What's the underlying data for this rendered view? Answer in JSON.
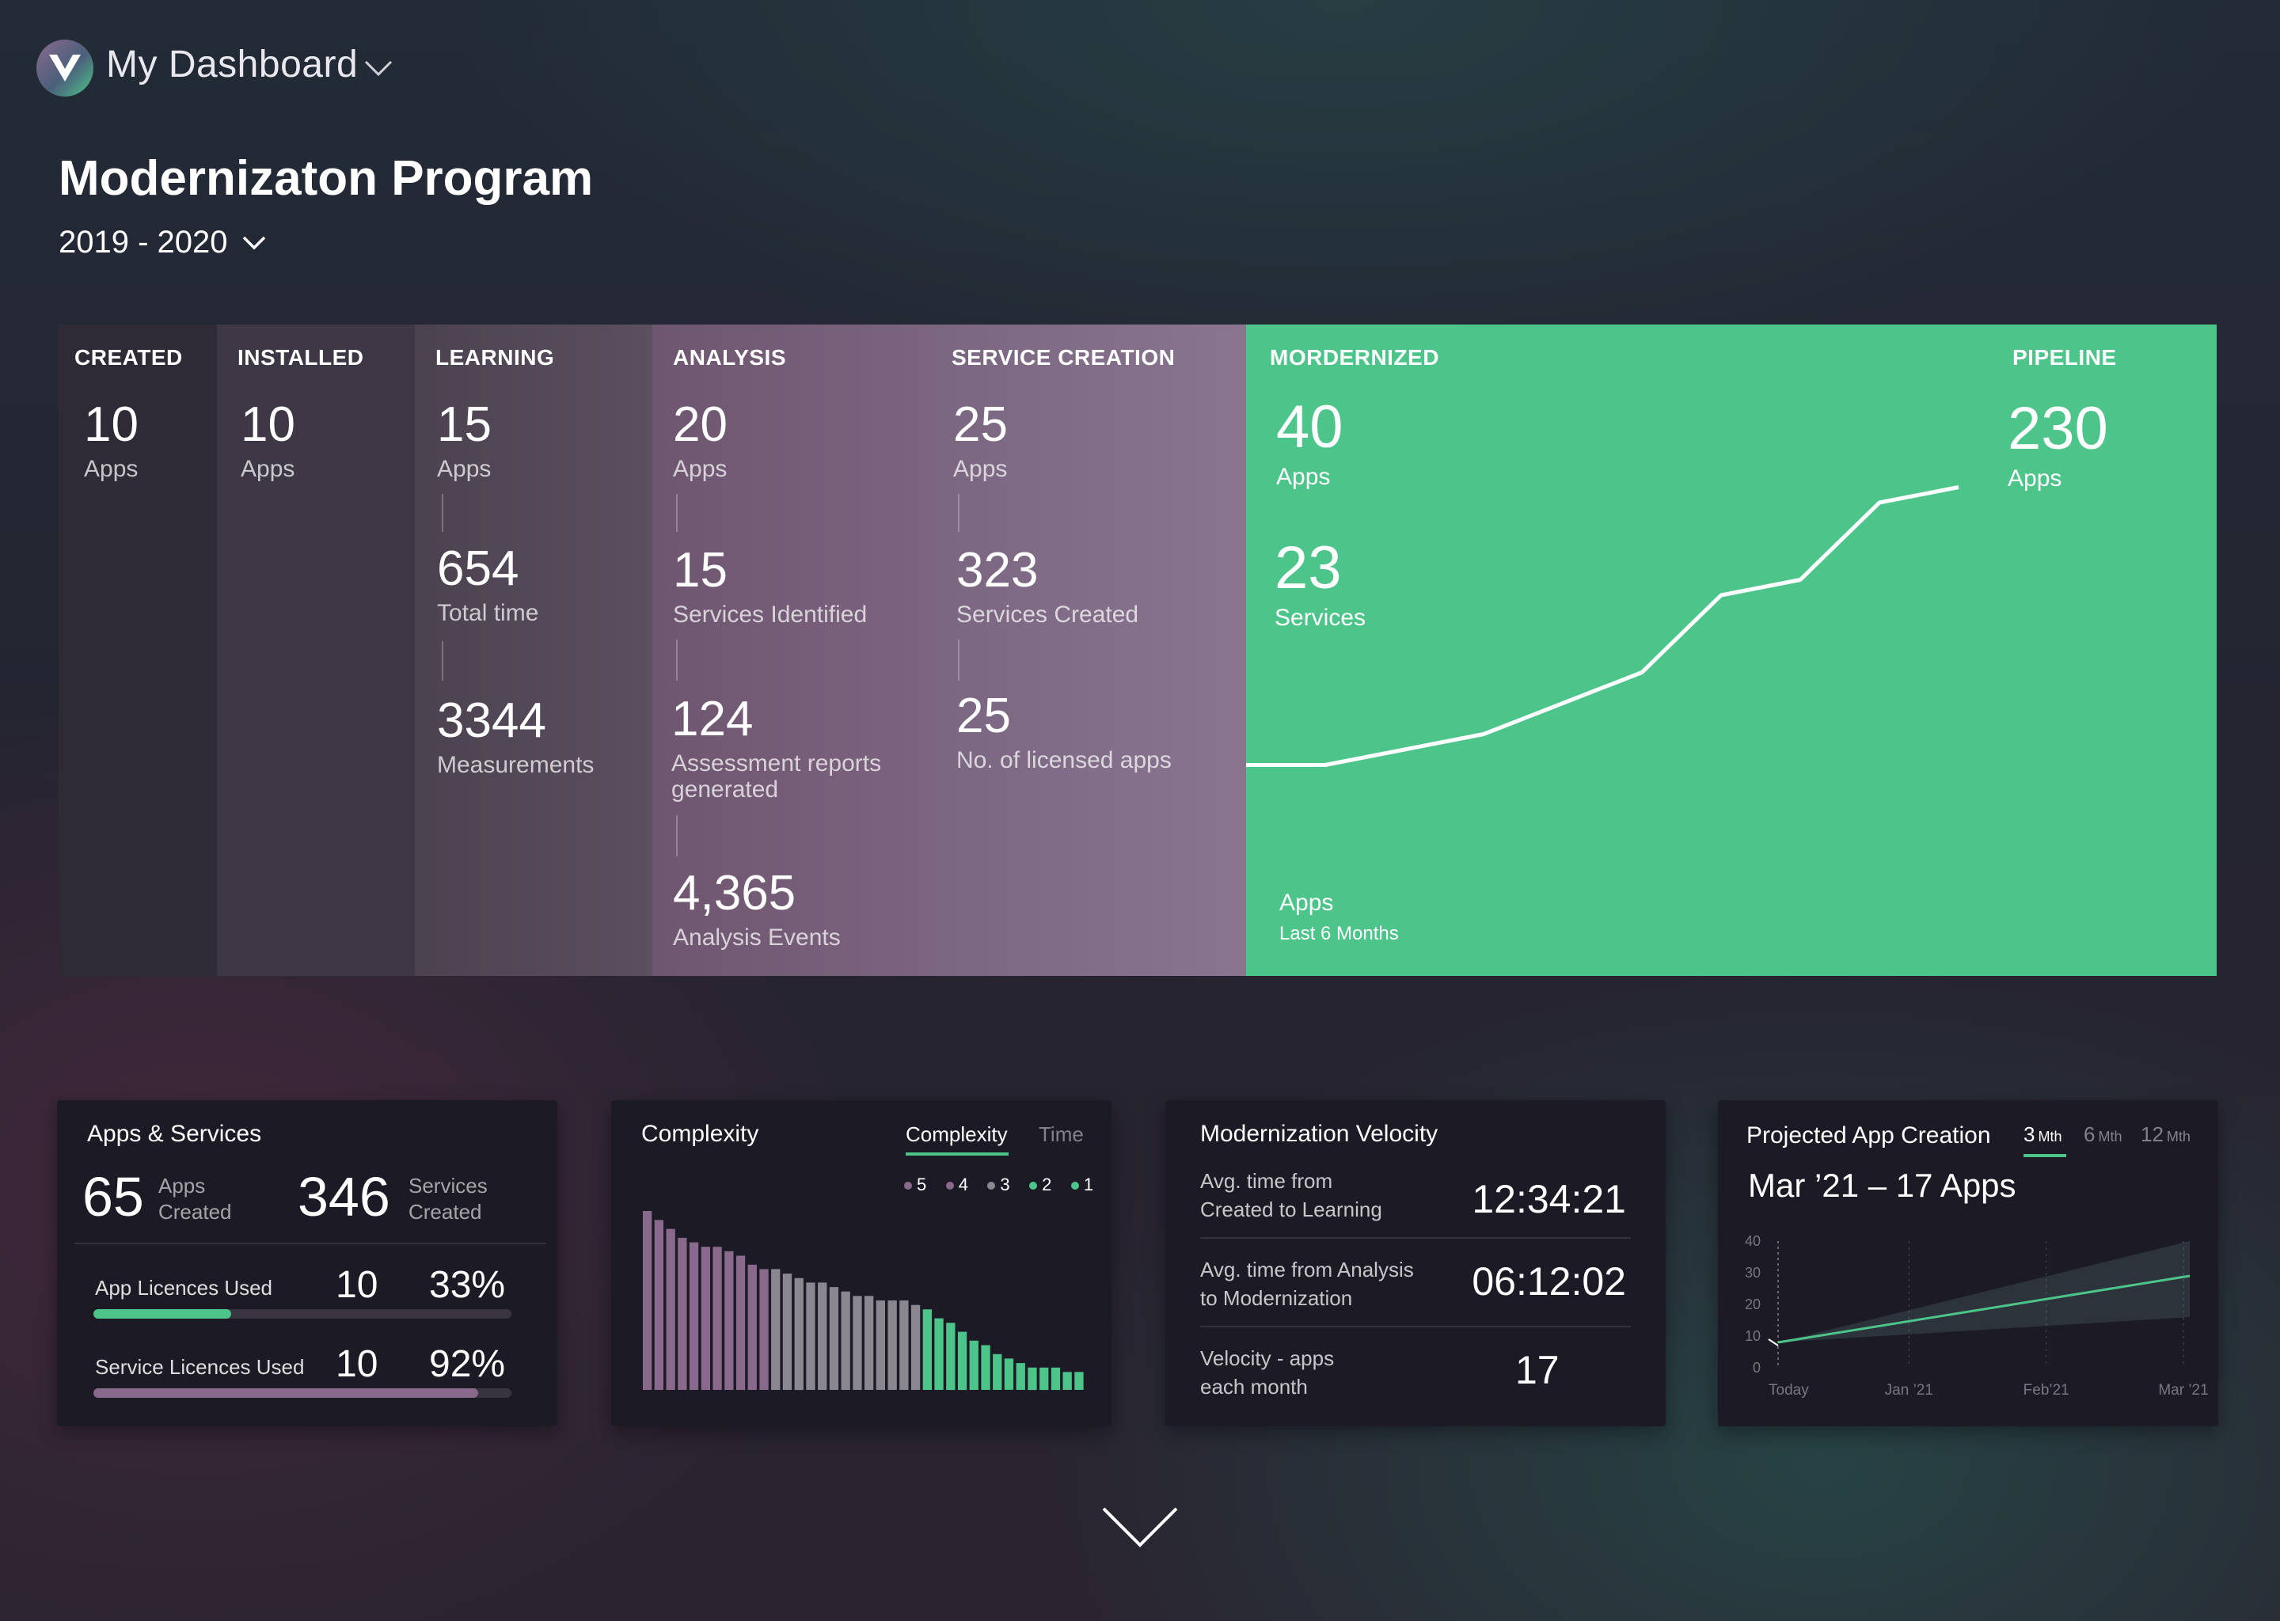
{
  "header": {
    "app_title": "My Dashboard",
    "page_title": "Modernizaton Program",
    "year_range": "2019 - 2020",
    "logo_letter": "V"
  },
  "stages": {
    "created": {
      "title": "CREATED",
      "metrics": [
        {
          "value": "10",
          "label": "Apps"
        }
      ]
    },
    "installed": {
      "title": "INSTALLED",
      "metrics": [
        {
          "value": "10",
          "label": "Apps"
        }
      ]
    },
    "learning": {
      "title": "LEARNING",
      "metrics": [
        {
          "value": "15",
          "label": "Apps"
        },
        {
          "value": "654",
          "label": "Total time"
        },
        {
          "value": "3344",
          "label": "Measurements"
        }
      ]
    },
    "analysis": {
      "title": "ANALYSIS",
      "metrics": [
        {
          "value": "20",
          "label": "Apps"
        },
        {
          "value": "15",
          "label": "Services Identified"
        },
        {
          "value": "124",
          "label": "Assessment reports generated"
        },
        {
          "value": "4,365",
          "label": "Analysis Events"
        }
      ]
    },
    "service_creation": {
      "title": "SERVICE CREATION",
      "metrics": [
        {
          "value": "25",
          "label": "Apps"
        },
        {
          "value": "323",
          "label": "Services Created"
        },
        {
          "value": "25",
          "label": "No. of licensed apps"
        }
      ]
    },
    "modernized": {
      "title": "MORDERNIZED",
      "metrics": [
        {
          "value": "40",
          "label": "Apps"
        },
        {
          "value": "23",
          "label": "Services"
        }
      ],
      "chart_label": "Apps",
      "chart_sublabel": "Last 6 Months"
    },
    "pipeline": {
      "title": "PIPELINE",
      "metrics": [
        {
          "value": "230",
          "label": "Apps"
        }
      ]
    }
  },
  "colors": {
    "accent_green": "#4dc58a",
    "purple": "#8a6a8c",
    "gray": "#8a8790",
    "card_bg": "#1c1b25"
  },
  "apps_services": {
    "title": "Apps & Services",
    "apps_created": {
      "value": "65",
      "label_1": "Apps",
      "label_2": "Created"
    },
    "services_created": {
      "value": "346",
      "label_1": "Services",
      "label_2": "Created"
    },
    "app_licences": {
      "label": "App Licences Used",
      "count": "10",
      "percent": "33%",
      "fraction": 0.33
    },
    "service_licences": {
      "label": "Service Licences Used",
      "count": "10",
      "percent": "92%",
      "fraction": 0.92
    }
  },
  "complexity": {
    "title": "Complexity",
    "tabs": [
      "Complexity",
      "Time"
    ],
    "active_tab": "Complexity",
    "legend": [
      {
        "label": "5",
        "color": "#8a6a8c"
      },
      {
        "label": "4",
        "color": "#8a6a8c"
      },
      {
        "label": "3",
        "color": "#8a8790"
      },
      {
        "label": "2",
        "color": "#4dc58a"
      },
      {
        "label": "1",
        "color": "#4dc58a"
      }
    ]
  },
  "velocity": {
    "title": "Modernization Velocity",
    "rows": [
      {
        "label_1": "Avg. time from",
        "label_2": "Created to Learning",
        "value": "12:34:21"
      },
      {
        "label_1": "Avg. time from Analysis",
        "label_2": "to Modernization",
        "value": "06:12:02"
      },
      {
        "label_1": "Velocity -  apps",
        "label_2": "each month",
        "value": "17"
      }
    ]
  },
  "projected": {
    "title": "Projected App Creation",
    "tabs": [
      {
        "num": "3",
        "unit": "Mth"
      },
      {
        "num": "6",
        "unit": "Mth"
      },
      {
        "num": "12",
        "unit": "Mth"
      }
    ],
    "active_tab": "3 Mth",
    "headline": "Mar ’21 –  17 Apps"
  },
  "chart_data": [
    {
      "type": "line",
      "series": [
        {
          "values": [
            1,
            1,
            2,
            3,
            5,
            7,
            12,
            13,
            18,
            19
          ]
        }
      ]
    },
    {
      "type": "bar",
      "values": [
        40,
        38,
        36,
        34,
        33,
        32,
        32,
        31,
        30,
        28,
        27,
        27,
        26,
        25,
        24,
        24,
        23,
        22,
        21,
        21,
        20,
        20,
        20,
        19,
        18,
        16,
        15,
        13,
        11,
        10,
        8,
        7,
        6,
        5,
        5,
        5,
        4,
        4
      ],
      "colors": [
        "#8a6a8c",
        "#8a6a8c",
        "#8a6a8c",
        "#8a6a8c",
        "#8a6a8c",
        "#8a6a8c",
        "#8a6a8c",
        "#8a6a8c",
        "#8a6a8c",
        "#8a6a8c",
        "#8a6a8c",
        "#8a8790",
        "#8a8790",
        "#8a8790",
        "#8a8790",
        "#8a8790",
        "#8a8790",
        "#8a8790",
        "#8a8790",
        "#8a8790",
        "#8a8790",
        "#8a8790",
        "#8a8790",
        "#8a8790",
        "#4dc58a",
        "#4dc58a",
        "#4dc58a",
        "#4dc58a",
        "#4dc58a",
        "#4dc58a",
        "#4dc58a",
        "#4dc58a",
        "#4dc58a",
        "#4dc58a",
        "#4dc58a",
        "#4dc58a",
        "#4dc58a",
        "#4dc58a"
      ]
    },
    {
      "type": "line",
      "categories": [
        "Today",
        "Jan ’21",
        "Feb’21",
        "Mar ’21"
      ],
      "ylim": [
        0,
        40
      ],
      "yticks": [
        "40",
        "30",
        "20",
        "10",
        "0"
      ],
      "series": [
        {
          "x": [
            0,
            3
          ],
          "values": [
            8,
            29
          ]
        }
      ],
      "band": {
        "upper_end": 40,
        "lower_end": 16
      }
    }
  ]
}
